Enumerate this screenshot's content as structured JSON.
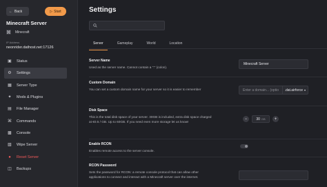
{
  "sidebar": {
    "back_label": "Back",
    "start_label": "Start",
    "server_title": "Minecraft Server",
    "game_name": "Minecraft",
    "ip_label": "IP Address",
    "ip_value": "neonrider.dathost.net:17126",
    "items": [
      {
        "label": "Status",
        "icon": "status-icon"
      },
      {
        "label": "Settings",
        "icon": "gear-icon",
        "active": true
      },
      {
        "label": "Server Type",
        "icon": "server-type-icon"
      },
      {
        "label": "Mods & Plugins",
        "icon": "puzzle-icon"
      },
      {
        "label": "File Manager",
        "icon": "file-icon"
      },
      {
        "label": "Commands",
        "icon": "commands-icon"
      },
      {
        "label": "Console",
        "icon": "console-icon"
      },
      {
        "label": "Wipe Server",
        "icon": "wipe-icon"
      },
      {
        "label": "Reset Server",
        "icon": "reset-icon",
        "danger": true
      },
      {
        "label": "Backups",
        "icon": "backup-icon"
      }
    ]
  },
  "main": {
    "title": "Settings",
    "search_placeholder": "",
    "tabs": [
      "Server",
      "Gameplay",
      "World",
      "Location"
    ],
    "active_tab": "Server",
    "accent_color": "#f29a4a",
    "danger_color": "#f05a5a",
    "settings": {
      "server_name": {
        "title": "Server Name",
        "desc": "Used as the server name. Cannot contain a \":\" (colon).",
        "value": "Minecraft Server"
      },
      "custom_domain": {
        "title": "Custom Domain",
        "desc": "You can set a custom domain name for your server so it is easier to remember",
        "placeholder": "Enter a domain... (optio",
        "suffix": ".dat.airforce"
      },
      "disk_space": {
        "title": "Disk Space",
        "desc": "This is the total disk space of your server. 30GB is included, extra disk space charged at €0.5 / GB. Up to 60GB. If you need even more storage let us know!",
        "value": "30",
        "unit": "GB",
        "minus": "−",
        "plus": "+"
      },
      "enable_rcon": {
        "title": "Enable RCON",
        "desc": "Enables remote access to the server console.",
        "enabled": false
      },
      "rcon_password": {
        "title": "RCON Password",
        "desc": "Sets the password for RCON: a remote console protocol that can allow other applications to connect and interact with a Minecraft server over the internet.",
        "value": ""
      }
    }
  }
}
